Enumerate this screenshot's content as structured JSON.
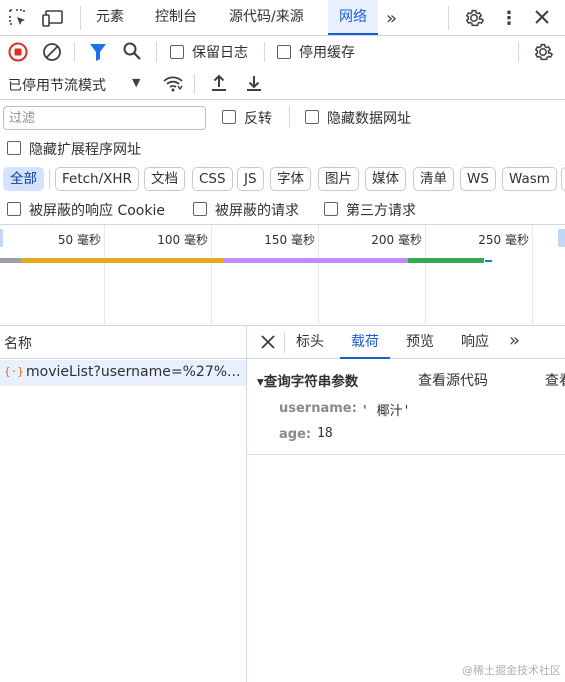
{
  "top_tabs": [
    {
      "label": "元素"
    },
    {
      "label": "控制台"
    },
    {
      "label": "源代码/来源"
    },
    {
      "label": "网络"
    }
  ],
  "toolbar": {
    "preserve_log_label": "保留日志",
    "disable_cache_label": "停用缓存",
    "throttling_label": "已停用节流模式"
  },
  "filter": {
    "placeholder": "过滤",
    "invert_label": "反转",
    "hide_data_urls_label": "隐藏数据网址",
    "hide_extension_urls_label": "隐藏扩展程序网址"
  },
  "type_chips": [
    {
      "label": "全部",
      "active": true
    },
    {
      "label": "Fetch/XHR"
    },
    {
      "label": "文档"
    },
    {
      "label": "CSS"
    },
    {
      "label": "JS"
    },
    {
      "label": "字体"
    },
    {
      "label": "图片"
    },
    {
      "label": "媒体"
    },
    {
      "label": "清单"
    },
    {
      "label": "WS"
    },
    {
      "label": "Wasm"
    }
  ],
  "blocked": {
    "blocked_cookies_label": "被屏蔽的响应 Cookie",
    "blocked_requests_label": "被屏蔽的请求",
    "third_party_label": "第三方请求"
  },
  "timeline": {
    "ticks": [
      "50 毫秒",
      "100 毫秒",
      "150 毫秒",
      "200 毫秒",
      "250 毫秒"
    ],
    "colors": {
      "stalled": "#9aa0a6",
      "waiting": "#e3ab1a",
      "ttfb": "#c58af9",
      "download": "#34a853",
      "tail": "#1a73e8"
    }
  },
  "requests": {
    "header": "名称",
    "items": [
      {
        "name": "movieList?username=%27%..."
      }
    ]
  },
  "details": {
    "tabs": [
      "标头",
      "载荷",
      "预览",
      "响应"
    ],
    "active_tab": "载荷",
    "section_title": "▾查询字符串参数",
    "view_source": "查看源代码",
    "view_decoded": "查看",
    "params": [
      {
        "key": "username:",
        "value": "' 椰汁'"
      },
      {
        "key": "age:",
        "value": "18"
      }
    ]
  },
  "watermark": "@稀土掘金技术社区"
}
